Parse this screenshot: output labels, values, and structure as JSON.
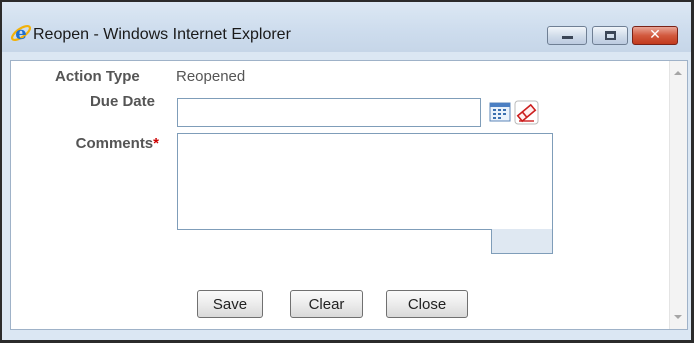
{
  "window": {
    "title": "Reopen - Windows Internet Explorer",
    "accent": "#c23a1d",
    "chrome_color": "#cddced"
  },
  "title_buttons": {
    "minimize": "minimize-icon",
    "maximize": "maximize-icon",
    "close": "✕"
  },
  "form": {
    "action_type_label": "Action Type",
    "action_type_value": "Reopened",
    "due_date_label": "Due Date",
    "due_date_value": "",
    "comments_label": "Comments",
    "required_marker": "*",
    "comments_value": "",
    "calendar_icon": "calendar-icon",
    "clear_date_icon": "eraser-icon",
    "required_color": "#cc0000",
    "label_color": "#555555"
  },
  "buttons": {
    "save": "Save",
    "clear": "Clear",
    "close": "Close"
  }
}
